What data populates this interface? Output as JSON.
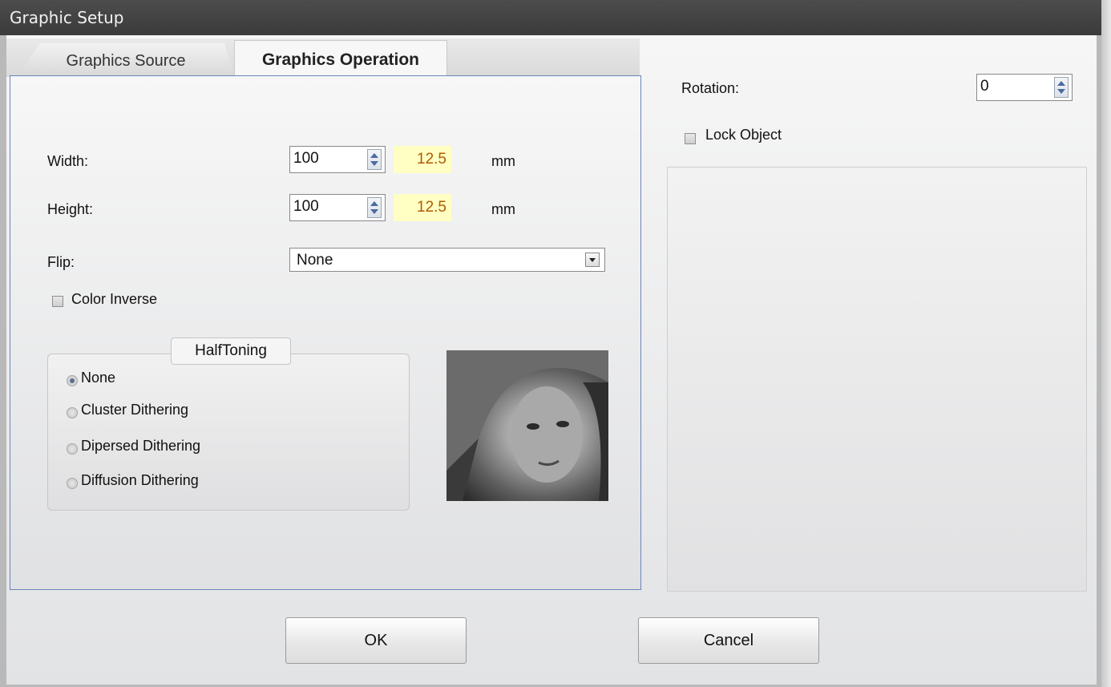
{
  "window": {
    "title": "Graphic Setup"
  },
  "tabs": {
    "source_label": "Graphics Source",
    "operation_label": "Graphics Operation",
    "active": "Graphics Operation"
  },
  "operation": {
    "width_label": "Width:",
    "width_value": "100",
    "width_mm": "12.5",
    "height_label": "Height:",
    "height_value": "100",
    "height_mm": "12.5",
    "unit": "mm",
    "flip_label": "Flip:",
    "flip_value": "None",
    "color_inverse_label": "Color Inverse",
    "color_inverse_checked": false,
    "halftoning": {
      "title": "HalfToning",
      "selected": "None",
      "options": [
        "None",
        "Cluster Dithering",
        "Dipersed Dithering",
        "Diffusion Dithering"
      ]
    }
  },
  "right": {
    "rotation_label": "Rotation:",
    "rotation_value": "0",
    "lock_object_label": "Lock Object",
    "lock_object_checked": false
  },
  "buttons": {
    "ok": "OK",
    "cancel": "Cancel"
  },
  "colors": {
    "titlebar": "#444444",
    "panel_border": "#6a86b8",
    "mm_field_bg": "#ffffc4",
    "mm_text": "#b35a00"
  }
}
